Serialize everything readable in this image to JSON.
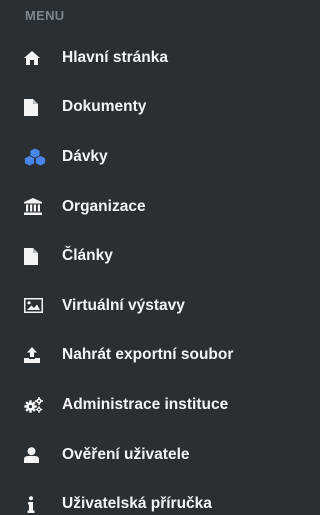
{
  "menu": {
    "header": "MENU",
    "items": [
      {
        "label": "Hlavní stránka",
        "icon": "home-icon"
      },
      {
        "label": "Dokumenty",
        "icon": "document-icon"
      },
      {
        "label": "Dávky",
        "icon": "cubes-icon",
        "icon_color": "#4a86e8"
      },
      {
        "label": "Organizace",
        "icon": "institution-icon"
      },
      {
        "label": "Články",
        "icon": "document-icon"
      },
      {
        "label": "Virtuální výstavy",
        "icon": "image-icon"
      },
      {
        "label": "Nahrát exportní soubor",
        "icon": "upload-icon"
      },
      {
        "label": "Administrace instituce",
        "icon": "cogs-icon"
      },
      {
        "label": "Ověření uživatele",
        "icon": "user-icon"
      },
      {
        "label": "Uživatelská příručka",
        "icon": "info-icon"
      }
    ]
  },
  "colors": {
    "background": "#2a2f34",
    "text": "#f2f4f5",
    "header_text": "#7e858b",
    "accent": "#4a86e8"
  }
}
